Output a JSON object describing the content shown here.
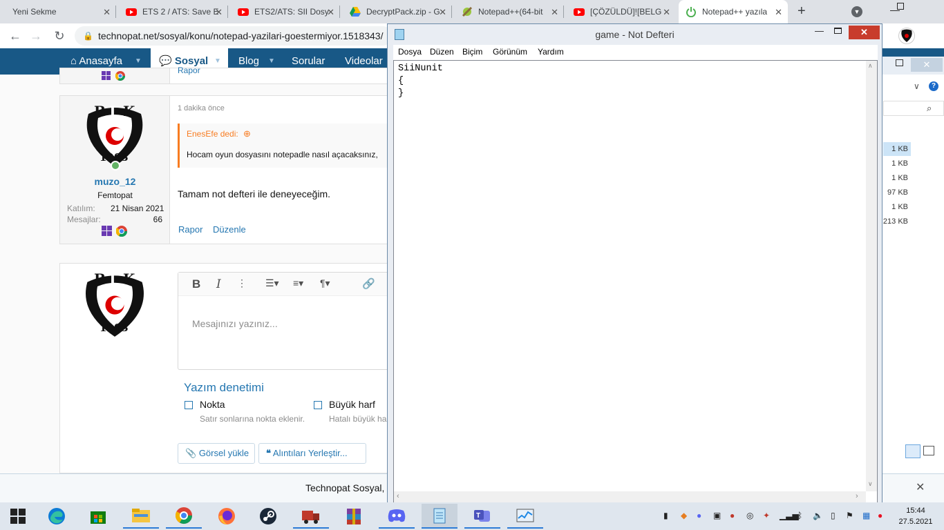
{
  "browser": {
    "tabs": [
      {
        "title": "Yeni Sekme",
        "icon": "blank-tab-icon"
      },
      {
        "title": "ETS 2 / ATS: Save E",
        "icon": "youtube-icon"
      },
      {
        "title": "ETS2/ATS: SII Dosy",
        "icon": "youtube-icon"
      },
      {
        "title": "DecryptPack.zip - G",
        "icon": "google-drive-icon"
      },
      {
        "title": "Notepad++(64-bit",
        "icon": "notepadpp-icon"
      },
      {
        "title": "[ÇÖZÜLDÜ]![BELG",
        "icon": "youtube-icon"
      },
      {
        "title": "Notepad++ yazıla",
        "icon": "power-icon"
      }
    ],
    "new_tab": "+",
    "url": "technopat.net/sosyal/konu/notepad-yazilari-goestermiyor.1518343/"
  },
  "site_nav": {
    "items": [
      "Anasayfa",
      "Sosyal",
      "Blog",
      "Sorular",
      "Videolar"
    ]
  },
  "post": {
    "prev_report": "Rapor",
    "time": "1 dakika önce",
    "quote_author": "EnesEfe dedi:",
    "quote_text": "Hocam oyun dosyasını notepadle nasıl açacaksınız,",
    "body": "Tamam not defteri ile deneyeceğim.",
    "report": "Rapor",
    "edit": "Düzenle",
    "user": {
      "name": "muzo_12",
      "title": "Femtopat",
      "joined_label": "Katılım:",
      "joined_value": "21 Nisan 2021",
      "messages_label": "Mesajlar:",
      "messages_value": "66"
    },
    "avatar_text": {
      "b": "B",
      "j": "J",
      "k": "K",
      "year": "1903"
    }
  },
  "reply": {
    "placeholder": "Mesajınızı yazınız...",
    "spellcheck_title": "Yazım denetimi",
    "option1_label": "Nokta",
    "option1_desc": "Satır sonlarına nokta eklenir.",
    "option2_label": "Büyük harf",
    "option2_desc": "Hatalı büyük ha",
    "upload_button": "Görsel yükle",
    "insert_quotes_button": "Alıntıları Yerleştir..."
  },
  "notice": {
    "text": "Technopat Sosyal,"
  },
  "explorer": {
    "sizes": [
      "1 KB",
      "1 KB",
      "1 KB",
      "97 KB",
      "1 KB",
      "213 KB"
    ]
  },
  "notepad": {
    "title": "game - Not Defteri",
    "menu": [
      "Dosya",
      "Düzen",
      "Biçim",
      "Görünüm",
      "Yardım"
    ],
    "content": "SiiNunit\n{\n}"
  },
  "taskbar": {
    "apps": [
      "windows-start-icon",
      "edge-icon",
      "store-icon",
      "file-explorer-icon",
      "chrome-icon",
      "firefox-icon",
      "steam-icon",
      "truck-game-icon",
      "winrar-icon",
      "discord-icon",
      "notepad-icon",
      "teams-icon",
      "task-manager-icon"
    ],
    "time": "15:44",
    "date": "27.5.2021"
  },
  "colors": {
    "brand": "#185886",
    "link": "#2577b1",
    "quote_accent": "#f87c21",
    "close_red": "#e81123"
  }
}
